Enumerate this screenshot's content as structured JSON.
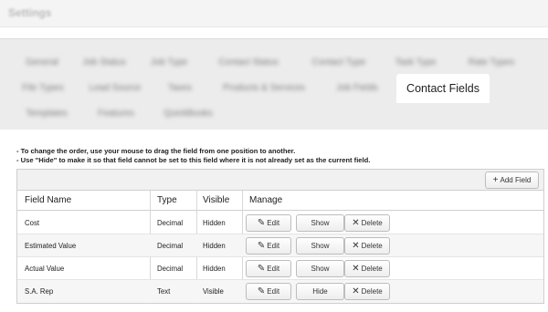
{
  "page": {
    "title": "Settings"
  },
  "tabs": [
    {
      "label": "General"
    },
    {
      "label": "Job Status"
    },
    {
      "label": "Job Type"
    },
    {
      "label": "Contact Status"
    },
    {
      "label": "Contact Type"
    },
    {
      "label": "Task Type"
    },
    {
      "label": "Rate Types"
    },
    {
      "label": "File Types"
    },
    {
      "label": "Lead Source"
    },
    {
      "label": "Taxes"
    },
    {
      "label": "Products & Services"
    },
    {
      "label": "Job Fields"
    },
    {
      "label": "Contact Fields",
      "active": true
    },
    {
      "label": "Templates"
    },
    {
      "label": "Features"
    },
    {
      "label": "QuickBooks"
    }
  ],
  "notes": [
    "- To change the order, use your mouse to drag the field from one position to another.",
    "- Use \"Hide\" to make it so that field cannot be set to this field where it is not already set as the current field."
  ],
  "toolbar": {
    "add_label": "Add Field",
    "add_icon": "+"
  },
  "table": {
    "headers": {
      "name": "Field Name",
      "type": "Type",
      "visible": "Visible",
      "manage": "Manage"
    },
    "edit_label": "Edit",
    "delete_label": "Delete",
    "rows": [
      {
        "name": "Cost",
        "type": "Decimal",
        "visible": "Hidden",
        "toggle": "Show"
      },
      {
        "name": "Estimated Value",
        "type": "Decimal",
        "visible": "Hidden",
        "toggle": "Show"
      },
      {
        "name": "Actual Value",
        "type": "Decimal",
        "visible": "Hidden",
        "toggle": "Show"
      },
      {
        "name": "S.A. Rep",
        "type": "Text",
        "visible": "Visible",
        "toggle": "Hide"
      }
    ]
  },
  "icons": {
    "edit": "pencil-icon",
    "delete": "close-icon",
    "add": "plus-icon"
  },
  "colors": {
    "tab_panel": "#ececec",
    "active_tab": "#ffffff",
    "alt_row": "#f6f6f6"
  }
}
